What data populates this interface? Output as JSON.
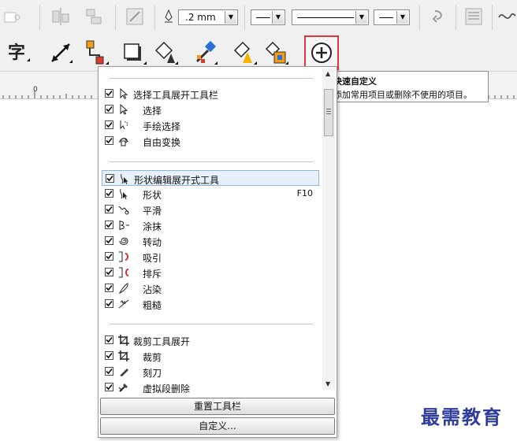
{
  "property_bar": {
    "outline_width": ".2 mm",
    "icons": [
      "stepper-icon",
      "align-icon",
      "distribute-icon",
      "transform-icon",
      "pen-icon",
      "line-style",
      "end-arrow",
      "text-wrap-icon",
      "wrap-icon",
      "curve-icon"
    ]
  },
  "toolbox": {
    "tools": [
      {
        "icon": "text-tool-icon",
        "label": "字"
      },
      {
        "icon": "dimension-tool-icon"
      },
      {
        "icon": "connector-tool-icon"
      },
      {
        "icon": "dropshadow-tool-icon"
      },
      {
        "icon": "fill-tool-icon"
      },
      {
        "icon": "eyedropper-tool-icon"
      },
      {
        "icon": "smart-fill-tool-icon"
      },
      {
        "icon": "interactive-fill-tool-icon"
      }
    ],
    "quick_customize_icon": "plus-circle-icon"
  },
  "tooltip": {
    "title": "快速自定义",
    "description": "添加常用项目或删除不使用的项目。"
  },
  "menu": {
    "groups": [
      {
        "header": "选择工具展开工具栏",
        "header_icon": "pointer-icon",
        "items": [
          {
            "label": "选择",
            "icon": "pointer-icon"
          },
          {
            "label": "手绘选择",
            "icon": "freehand-select-icon"
          },
          {
            "label": "自由变换",
            "icon": "free-transform-icon"
          }
        ]
      },
      {
        "header": "形状编辑展开式工具",
        "header_icon": "shape-tool-icon",
        "items": [
          {
            "label": "形状",
            "icon": "shape-tool-icon",
            "shortcut": "F10"
          },
          {
            "label": "平滑",
            "icon": "smooth-icon"
          },
          {
            "label": "涂抹",
            "icon": "smear-icon"
          },
          {
            "label": "转动",
            "icon": "twirl-icon"
          },
          {
            "label": "吸引",
            "icon": "attract-icon"
          },
          {
            "label": "排斥",
            "icon": "repel-icon"
          },
          {
            "label": "沾染",
            "icon": "smudge-icon"
          },
          {
            "label": "粗糙",
            "icon": "roughen-icon"
          }
        ]
      },
      {
        "header": "裁剪工具展开",
        "header_icon": "crop-icon",
        "items": [
          {
            "label": "裁剪",
            "icon": "crop-icon"
          },
          {
            "label": "刻刀",
            "icon": "knife-icon"
          },
          {
            "label": "虚拟段删除",
            "icon": "virtual-segment-delete-icon"
          }
        ]
      }
    ],
    "reset_button": "重置工具栏",
    "customize_button": "自定义..."
  },
  "ruler": {
    "origin_label": "0"
  },
  "watermark": "最需教育",
  "colors": {
    "highlight_border": "#8ab6e4",
    "highlight_bg": "#e8f1fb",
    "callout_red": "#e53935",
    "watermark": "#2f3c9c"
  }
}
